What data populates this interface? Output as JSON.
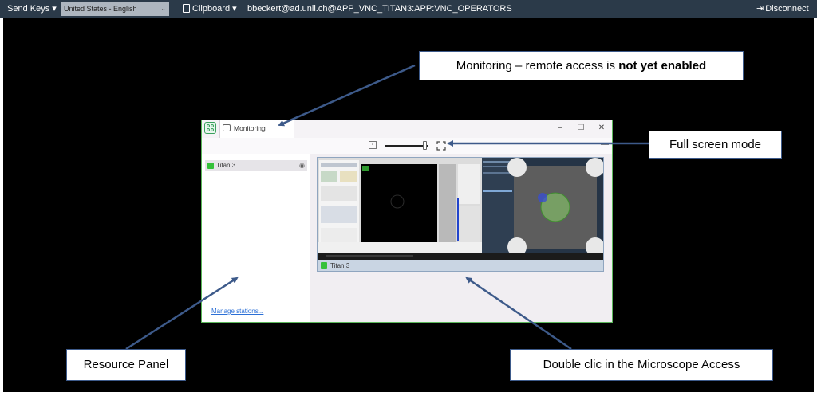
{
  "vnc_bar": {
    "send_keys": "Send Keys ▾",
    "language": "United States - English",
    "clipboard": "Clipboard ▾",
    "connection": "bbeckert@ad.unil.ch@APP_VNC_TITAN3:APP:VNC_OPERATORS",
    "disconnect": "Disconnect"
  },
  "app": {
    "tab_label": "Monitoring",
    "station_name": "Titan 3",
    "manage_link": "Manage stations...",
    "preview_label": "Titan 3",
    "zoom_level": 0.93
  },
  "callouts": {
    "monitoring_prefix": "Monitoring – remote access is ",
    "monitoring_bold": "not yet enabled",
    "full_screen": "Full screen mode",
    "resource_panel": "Resource Panel",
    "double_click": "Double clic in the Microscope Access"
  },
  "colors": {
    "vnc_bar": "#2b3a49",
    "window_border": "#5bb75a",
    "status_green": "#35c13a",
    "arrow": "#3d5a8a"
  }
}
